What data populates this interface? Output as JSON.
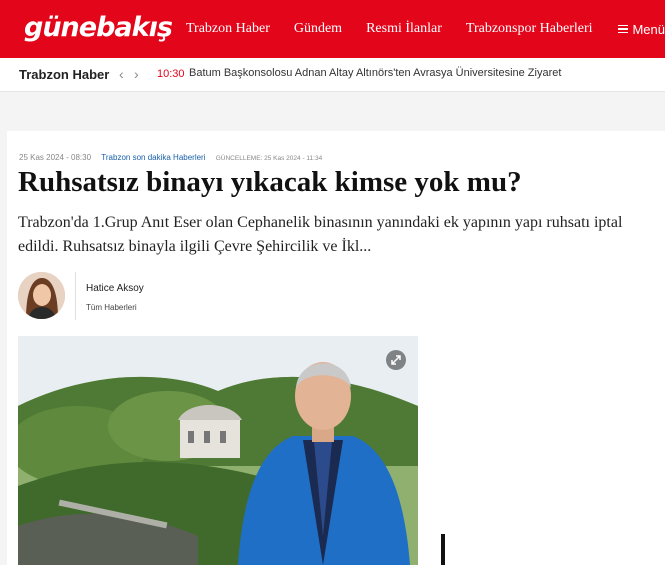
{
  "header": {
    "logo": "günebakış",
    "nav": [
      "Trabzon Haber",
      "Gündem",
      "Resmi İlanlar",
      "Trabzonspor Haberleri"
    ],
    "menu_label": "Menü",
    "brand_color": "#e3061b"
  },
  "ticker": {
    "title": "Trabzon Haber",
    "time": "10:30",
    "text": "Batum Başkonsolosu Adnan Altay Altınörs'ten Avrasya Üniversitesine Ziyaret"
  },
  "article": {
    "date": "25 Kas 2024 - 08:30",
    "category": "Trabzon son dakika Haberleri",
    "updated": "GÜNCELLEME: 25 Kas 2024 - 11:34",
    "headline": "Ruhsatsız binayı yıkacak kimse yok mu?",
    "spot": "Trabzon'da 1.Grup Anıt Eser olan Cephanelik binasının yanındaki ek yapının yapı ruhsatı iptal edildi. Ruhsatsız binayla ilgili Çevre Şehircilik ve İkl...",
    "author_name": "Hatice Aksoy",
    "author_link": "Tüm Haberleri"
  }
}
